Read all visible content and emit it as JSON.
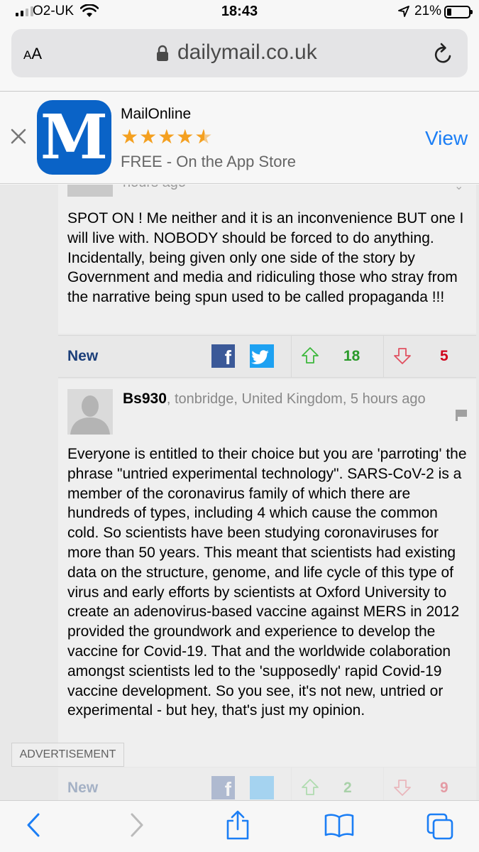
{
  "status_bar": {
    "carrier": "O2-UK",
    "time": "18:43",
    "battery": "21%",
    "battery_level": 0.21
  },
  "browser": {
    "text_size_label_small": "A",
    "text_size_label_large": "A",
    "domain": "dailymail.co.uk"
  },
  "app_banner": {
    "app_name": "MailOnline",
    "rating": 4.5,
    "rating_stars": "★★★★",
    "rating_half_star": "★",
    "subtitle": "FREE - On the App Store",
    "view_label": "View",
    "app_icon_letter": "M",
    "brand_color": "#0a63c7"
  },
  "comments": [
    {
      "time": "hours ago",
      "body": "SPOT ON ! Me neither and it is an inconvenience BUT one I will live with. NOBODY should be forced to do anything. Incidentally, being given only one side of the story by Government and media and ridiculing those who stray from the narrative being spun used to be called propaganda !!!",
      "new_label": "New",
      "upvotes": "18",
      "downvotes": "5"
    },
    {
      "username": "Bs930",
      "location_time": ", tonbridge, United Kingdom, 5 hours ago",
      "body": "Everyone is entitled to their choice but you are 'parroting' the phrase \"untried experimental technology\". SARS-CoV-2 is a member of the coronavirus family of which there are hundreds of types, including 4 which cause the common cold. So scientists have been studying coronaviruses for more than 50 years. This meant that scientists had existing data on the structure, genome, and life cycle of this type of virus and early efforts by scientists at Oxford University to create an adenovirus-based vaccine against MERS in 2012 provided the groundwork and experience to develop the vaccine for Covid-19. That and the worldwide colaboration amongst scientists led to the 'supposedly' rapid Covid-19 vaccine development. So you see, it's not new, untried or experimental - but hey, that's just my opinion.",
      "new_label": "New",
      "upvotes": "2",
      "downvotes": "9"
    }
  ],
  "advertisement_label": "ADVERTISEMENT",
  "colors": {
    "link_blue": "#1b7ef5",
    "upvote_green": "#2a9a2a",
    "downvote_red": "#d0021b",
    "facebook": "#3b5998",
    "twitter": "#1da1f2"
  }
}
